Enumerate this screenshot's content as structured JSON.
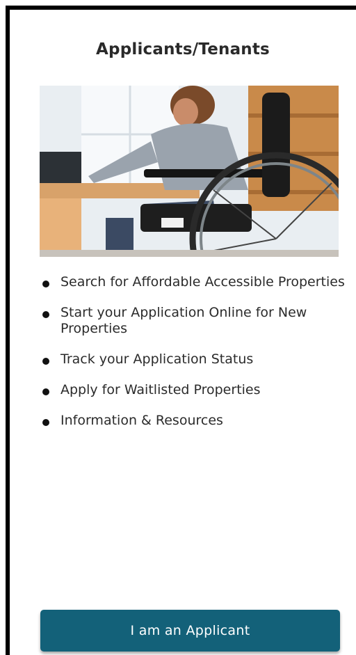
{
  "section": {
    "title": "Applicants/Tenants"
  },
  "photo": {
    "subject": "person-in-wheelchair-at-desk"
  },
  "features": [
    {
      "label": "Search for Affordable Accessible Properties"
    },
    {
      "label": "Start your Application Online for New Properties"
    },
    {
      "label": "Track your Application Status"
    },
    {
      "label": "Apply for Waitlisted Properties"
    },
    {
      "label": "Information & Resources"
    }
  ],
  "cta": {
    "label": "I am an Applicant"
  },
  "colors": {
    "button": "#136179",
    "title": "#2a2a2a",
    "text": "#2b2b2b",
    "border": "#000000"
  }
}
